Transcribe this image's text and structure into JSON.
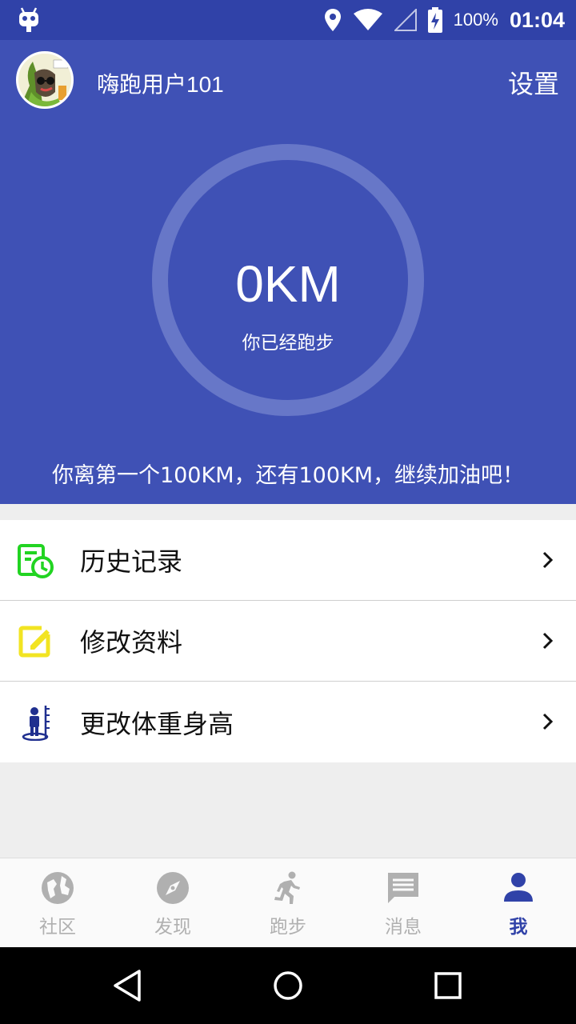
{
  "status_bar": {
    "battery": "100%",
    "time": "01:04"
  },
  "header": {
    "username": "嗨跑用户101",
    "settings_label": "设置",
    "distance": "0KM",
    "distance_label": "你已经跑步",
    "motivation": "你离第一个100KM，还有100KM，继续加油吧！"
  },
  "menu": {
    "items": [
      {
        "label": "历史记录",
        "icon": "history-icon",
        "color": "#22d422"
      },
      {
        "label": "修改资料",
        "icon": "edit-icon",
        "color": "#f2e422"
      },
      {
        "label": "更改体重身高",
        "icon": "height-weight-icon",
        "color": "#1f2f8f"
      }
    ]
  },
  "bottom_nav": {
    "items": [
      {
        "label": "社区",
        "icon": "globe-icon",
        "active": false
      },
      {
        "label": "发现",
        "icon": "compass-icon",
        "active": false
      },
      {
        "label": "跑步",
        "icon": "runner-icon",
        "active": false
      },
      {
        "label": "消息",
        "icon": "message-icon",
        "active": false
      },
      {
        "label": "我",
        "icon": "person-icon",
        "active": true
      }
    ]
  },
  "colors": {
    "primary": "#3f51b5",
    "primary_dark": "#3042a8",
    "inactive": "#b0b0b0"
  }
}
